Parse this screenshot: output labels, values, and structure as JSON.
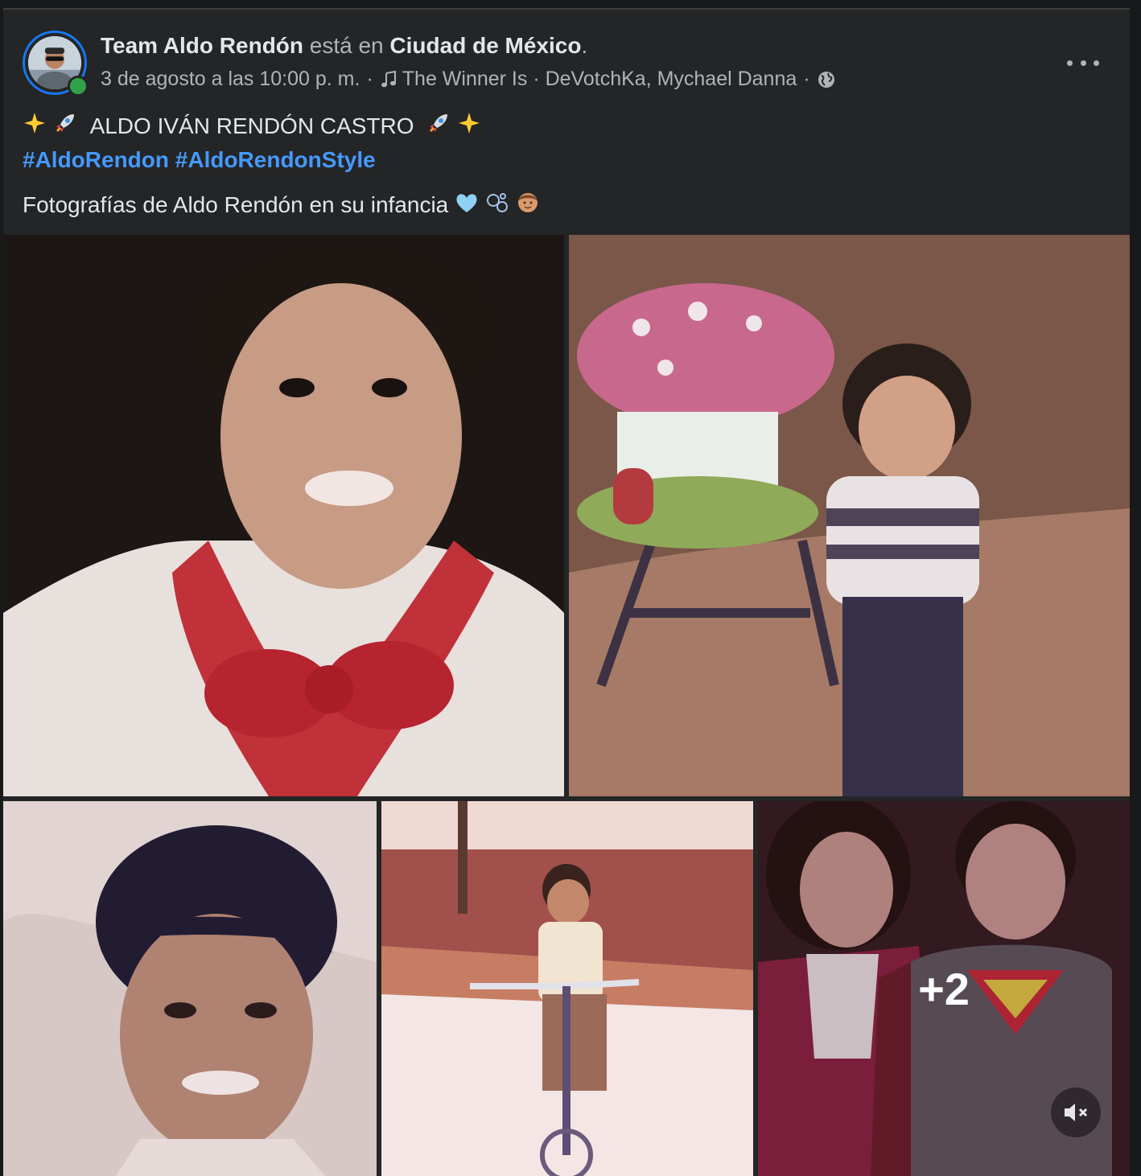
{
  "post": {
    "author": "Team Aldo Rendón",
    "connector": "está en",
    "location": "Ciudad de México",
    "location_end": ".",
    "date": "3 de agosto a las 10:00 p. m.",
    "music": "The Winner Is · DeVotchKa, Mychael Danna",
    "separator": "·",
    "audience_icon": "globe-icon",
    "online_status": "online",
    "title_text": "ALDO IVÁN RENDÓN CASTRO",
    "hashtags": [
      "#AldoRendon",
      "#AldoRendonStyle"
    ],
    "caption": "Fotografías de Aldo Rendón en su infancia"
  },
  "gallery": {
    "photos": [
      {
        "alt": "photo-child-red-bow"
      },
      {
        "alt": "photo-toddler-mushroom-chair"
      },
      {
        "alt": "photo-boy-smiling"
      },
      {
        "alt": "photo-boy-bicycle"
      },
      {
        "alt": "photo-siblings-superman"
      }
    ],
    "more_count": "+2"
  },
  "colors": {
    "background": "#242526",
    "text": "#e4e6eb",
    "secondary_text": "#b0b3b8",
    "link": "#4599ff",
    "online": "#31a24c",
    "avatar_ring": "#1877f2"
  }
}
